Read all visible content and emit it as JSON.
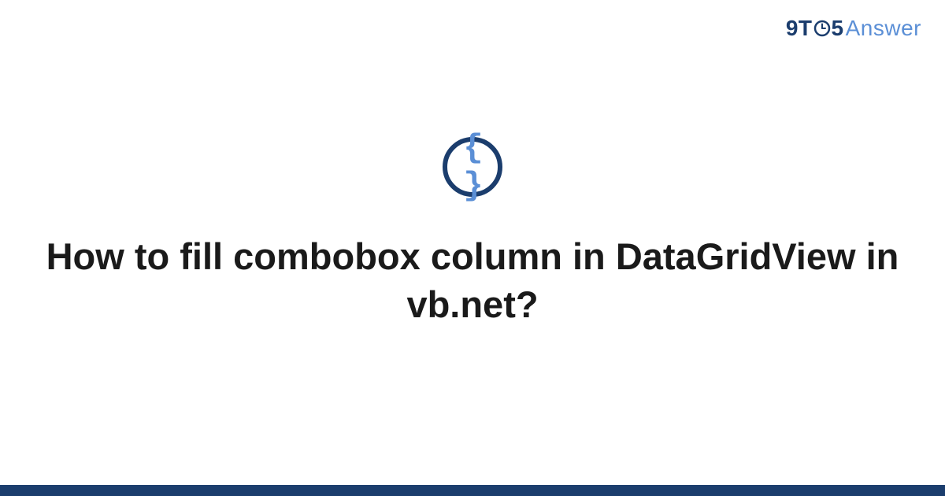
{
  "header": {
    "brand_prefix": "9T",
    "brand_five": "5",
    "brand_suffix": "Answer"
  },
  "icon": {
    "braces": "{ }"
  },
  "main": {
    "title": "How to fill combobox column in DataGridView in vb.net?"
  }
}
